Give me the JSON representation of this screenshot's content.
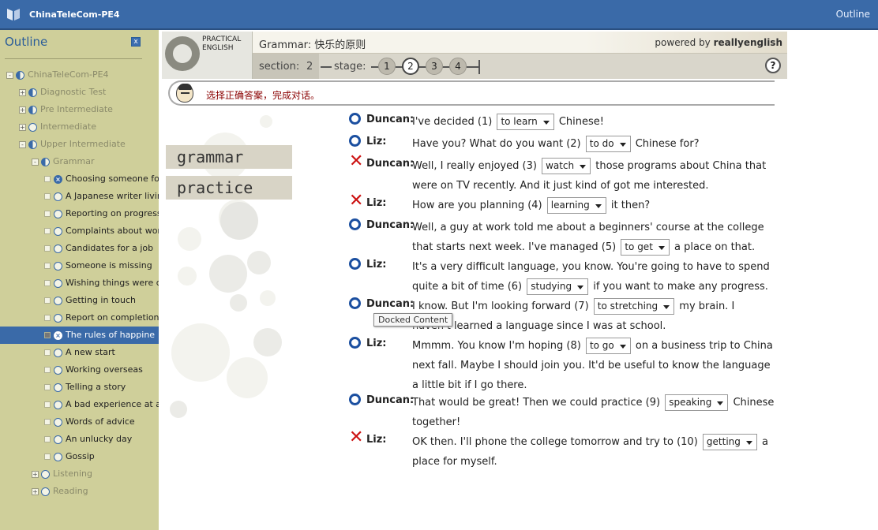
{
  "topbar": {
    "app_title": "ChinaTeleCom-PE4",
    "outline_link": "Outline"
  },
  "sidebar": {
    "header": "Outline",
    "close_glyph": "x",
    "items": [
      {
        "label": "ChinaTeleCom-PE4",
        "level": 0,
        "expander": "-",
        "status": "half"
      },
      {
        "label": "Diagnostic Test",
        "level": 1,
        "expander": "+",
        "status": "half"
      },
      {
        "label": "Pre Intermediate",
        "level": 1,
        "expander": "+",
        "status": "half"
      },
      {
        "label": "Intermediate",
        "level": 1,
        "expander": "+",
        "status": "empty"
      },
      {
        "label": "Upper Intermediate",
        "level": 1,
        "expander": "-",
        "status": "half"
      },
      {
        "label": "Grammar",
        "level": 2,
        "expander": "-",
        "status": "half"
      },
      {
        "label": "Choosing someone for a",
        "level": 3,
        "status": "x",
        "dark": true
      },
      {
        "label": "A Japanese writer living",
        "level": 3,
        "status": "empty",
        "dark": true
      },
      {
        "label": "Reporting on progress",
        "level": 3,
        "status": "empty",
        "dark": true
      },
      {
        "label": "Complaints about work",
        "level": 3,
        "status": "empty",
        "dark": true
      },
      {
        "label": "Candidates for a job",
        "level": 3,
        "status": "empty",
        "dark": true
      },
      {
        "label": "Someone is missing",
        "level": 3,
        "status": "empty",
        "dark": true
      },
      {
        "label": "Wishing things were di",
        "level": 3,
        "status": "empty",
        "dark": true
      },
      {
        "label": "Getting in touch",
        "level": 3,
        "status": "empty",
        "dark": true
      },
      {
        "label": "Report on completion o",
        "level": 3,
        "status": "empty",
        "dark": true
      },
      {
        "label": "The rules of happine",
        "level": 3,
        "status": "x",
        "selected": true
      },
      {
        "label": "A new start",
        "level": 3,
        "status": "empty",
        "dark": true
      },
      {
        "label": "Working overseas",
        "level": 3,
        "status": "empty",
        "dark": true
      },
      {
        "label": "Telling a story",
        "level": 3,
        "status": "empty",
        "dark": true
      },
      {
        "label": "A bad experience at a",
        "level": 3,
        "status": "empty",
        "dark": true
      },
      {
        "label": "Words of advice",
        "level": 3,
        "status": "empty",
        "dark": true
      },
      {
        "label": "An unlucky day",
        "level": 3,
        "status": "empty",
        "dark": true
      },
      {
        "label": "Gossip",
        "level": 3,
        "status": "empty",
        "dark": true
      },
      {
        "label": "Listening",
        "level": 2,
        "expander": "+",
        "status": "empty"
      },
      {
        "label": "Reading",
        "level": 2,
        "expander": "+",
        "status": "empty"
      }
    ]
  },
  "header": {
    "logo_line1": "PRACTICAL",
    "logo_line2": "ENGLISH",
    "title": "Grammar: 快乐的原则",
    "powered_prefix": "powered by ",
    "powered_brand": "reallyenglish",
    "section_label": "section:",
    "section_value": "2",
    "stage_label": "stage:",
    "stages": [
      "1",
      "2",
      "3",
      "4"
    ],
    "active_stage": "2",
    "help_glyph": "?"
  },
  "instruction": "选择正确答案，完成对话。",
  "tabs": {
    "grammar": "grammar",
    "practice": "practice"
  },
  "tooltip": "Docked Content",
  "dialogue": [
    {
      "mark": "o",
      "speaker": "Duncan:",
      "parts": [
        "I've decided (1)",
        {
          "select": "to learn"
        },
        "Chinese!"
      ]
    },
    {
      "mark": "o",
      "speaker": "Liz:",
      "parts": [
        "Have you? What do you want (2)",
        {
          "select": "to do"
        },
        "Chinese for?"
      ]
    },
    {
      "mark": "x",
      "speaker": "Duncan:",
      "parts": [
        "Well, I really enjoyed (3)",
        {
          "select": "watch"
        },
        "those programs about China that were on TV recently. And it just kind of got me interested."
      ]
    },
    {
      "mark": "x",
      "speaker": "Liz:",
      "parts": [
        "How are you planning (4)",
        {
          "select": "learning"
        },
        "it then?"
      ]
    },
    {
      "mark": "o",
      "speaker": "Duncan:",
      "parts": [
        "Well, a guy at work told me about a beginners' course at the college that starts next week. I've managed (5)",
        {
          "select": "to get"
        },
        "a place on that."
      ]
    },
    {
      "mark": "o",
      "speaker": "Liz:",
      "parts": [
        "It's a very difficult language, you know. You're going to have to spend quite a bit of time (6)",
        {
          "select": "studying"
        },
        "if you want to make any progress."
      ]
    },
    {
      "mark": "o",
      "speaker": "Duncan:",
      "parts": [
        "I know. But I'm looking forward (7)",
        {
          "select": "to stretching"
        },
        "my brain. I haven't learned a language since I was at school."
      ]
    },
    {
      "mark": "o",
      "speaker": "Liz:",
      "parts": [
        "Mmmm. You know I'm hoping (8)",
        {
          "select": "to go"
        },
        "on a business trip to China next fall. Maybe I should join you. It'd be useful to know the language a little bit if I go there."
      ]
    },
    {
      "mark": "o",
      "speaker": "Duncan:",
      "parts": [
        "That would be great! Then we could practice (9)",
        {
          "select": "speaking"
        },
        "Chinese together!"
      ]
    },
    {
      "mark": "x",
      "speaker": "Liz:",
      "parts": [
        "OK then. I'll phone the college tomorrow and try to (10)",
        {
          "select": "getting"
        },
        "a place for myself."
      ]
    }
  ],
  "colors": {
    "topbar": "#3a6aa8",
    "sidebar": "#cfcf9a",
    "correct": "#1b4fa0",
    "wrong": "#cc1111",
    "instruction": "#8a0000"
  }
}
